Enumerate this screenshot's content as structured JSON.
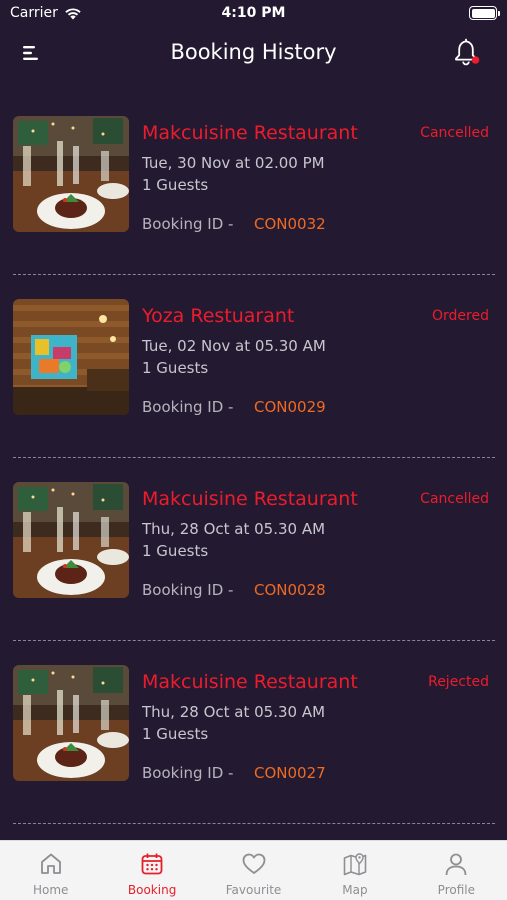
{
  "status_bar": {
    "carrier": "Carrier",
    "time": "4:10 PM"
  },
  "header": {
    "title": "Booking History"
  },
  "bookings": [
    {
      "name": "Makcuisine Restaurant",
      "status": "Cancelled",
      "date": "Tue, 30 Nov at 02.00 PM",
      "guests": "1 Guests",
      "id_label": "Booking ID -",
      "id": "CON0032",
      "image": "steak-dinner-photo"
    },
    {
      "name": "Yoza Restuarant",
      "status": "Ordered",
      "date": "Tue, 02 Nov at 05.30 AM",
      "guests": "1 Guests",
      "id_label": "Booking ID -",
      "id": "CON0029",
      "image": "restaurant-interior-photo"
    },
    {
      "name": "Makcuisine Restaurant",
      "status": "Cancelled",
      "date": "Thu, 28 Oct at 05.30 AM",
      "guests": "1 Guests",
      "id_label": "Booking ID -",
      "id": "CON0028",
      "image": "steak-dinner-photo"
    },
    {
      "name": "Makcuisine Restaurant",
      "status": "Rejected",
      "date": "Thu, 28 Oct at 05.30 AM",
      "guests": "1 Guests",
      "id_label": "Booking ID -",
      "id": "CON0027",
      "image": "steak-dinner-photo"
    }
  ],
  "tab_bar": {
    "tabs": [
      {
        "label": "Home",
        "icon": "home-icon"
      },
      {
        "label": "Booking",
        "icon": "calendar-icon"
      },
      {
        "label": "Favourite",
        "icon": "heart-icon"
      },
      {
        "label": "Map",
        "icon": "map-icon"
      },
      {
        "label": "Profile",
        "icon": "user-icon"
      }
    ],
    "active_index": 1
  },
  "colors": {
    "background": "#231a31",
    "accent_red": "#ec1c2c",
    "booking_id_orange": "#ee6a24",
    "secondary_text": "#c8c5ce"
  }
}
